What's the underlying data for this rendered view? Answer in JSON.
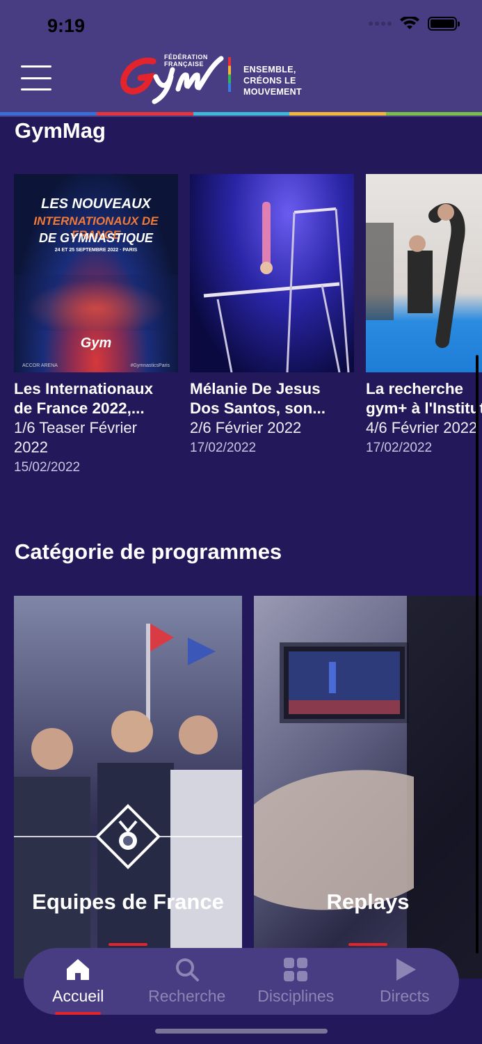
{
  "status": {
    "time": "9:19"
  },
  "header": {
    "logo_federation": "FÉDÉRATION FRANÇAISE",
    "logo_tagline_line1": "ENSEMBLE,",
    "logo_tagline_line2": "CRÉONS LE MOUVEMENT"
  },
  "gymmag": {
    "title": "GymMag",
    "cards": [
      {
        "title": "Les Internationaux de France 2022,...",
        "title_line1": "Les Internationaux",
        "title_line2": "de France 2022,...",
        "subtitle_line1": "1/6 Teaser Février",
        "subtitle_line2": "2022",
        "date": "15/02/2022",
        "poster_line1": "LES NOUVEAUX",
        "poster_line2": "INTERNATIONAUX DE FRANCE",
        "poster_line3": "DE GYMNASTIQUE",
        "poster_dates": "24 ET 25 SEPTEMBRE 2022 · PARIS",
        "poster_footer_left": "ACCOR ARENA",
        "poster_footer_right": "#GymnasticsParis"
      },
      {
        "title_line1": "Mélanie De Jesus",
        "title_line2": "Dos Santos, son...",
        "subtitle_line1": "2/6 Février 2022",
        "date": "17/02/2022"
      },
      {
        "title_line1": "La recherche",
        "title_line2": "gym+ à l'Institut",
        "subtitle_line1": "4/6 Février 2022",
        "date": "17/02/2022"
      }
    ]
  },
  "categories": {
    "title": "Catégorie de programmes",
    "items": [
      {
        "label": "Equipes de France"
      },
      {
        "label": "Replays"
      }
    ]
  },
  "tabbar": {
    "items": [
      {
        "label": "Accueil",
        "icon": "home-icon",
        "active": true
      },
      {
        "label": "Recherche",
        "icon": "search-icon",
        "active": false
      },
      {
        "label": "Disciplines",
        "icon": "grid-icon",
        "active": false
      },
      {
        "label": "Directs",
        "icon": "play-icon",
        "active": false
      }
    ]
  },
  "colors": {
    "background": "#23195a",
    "header": "#483c82",
    "accent_red": "#e3242d"
  }
}
